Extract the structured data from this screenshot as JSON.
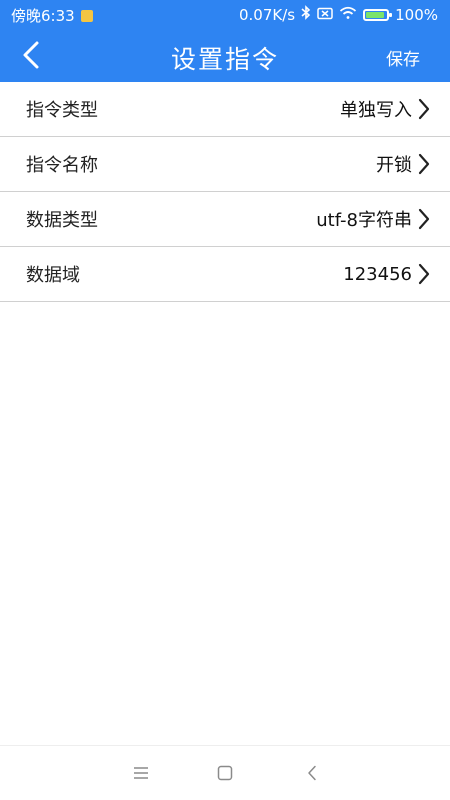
{
  "status_bar": {
    "time": "傍晚6:33",
    "speed": "0.07K/s",
    "battery": "100%",
    "icons": [
      "notification-icon",
      "bluetooth-icon",
      "sim-icon",
      "wifi-icon",
      "battery-charging-icon"
    ]
  },
  "header": {
    "title": "设置指令",
    "save_label": "保存",
    "back_icon": "chevron-left-icon",
    "background_color": "#2e84f2"
  },
  "settings": [
    {
      "label": "指令类型",
      "value": "单独写入"
    },
    {
      "label": "指令名称",
      "value": "开锁"
    },
    {
      "label": "数据类型",
      "value": "utf-8字符串"
    },
    {
      "label": "数据域",
      "value": "123456"
    }
  ],
  "system_nav": {
    "icons": [
      "menu-icon",
      "home-icon",
      "back-icon"
    ]
  }
}
